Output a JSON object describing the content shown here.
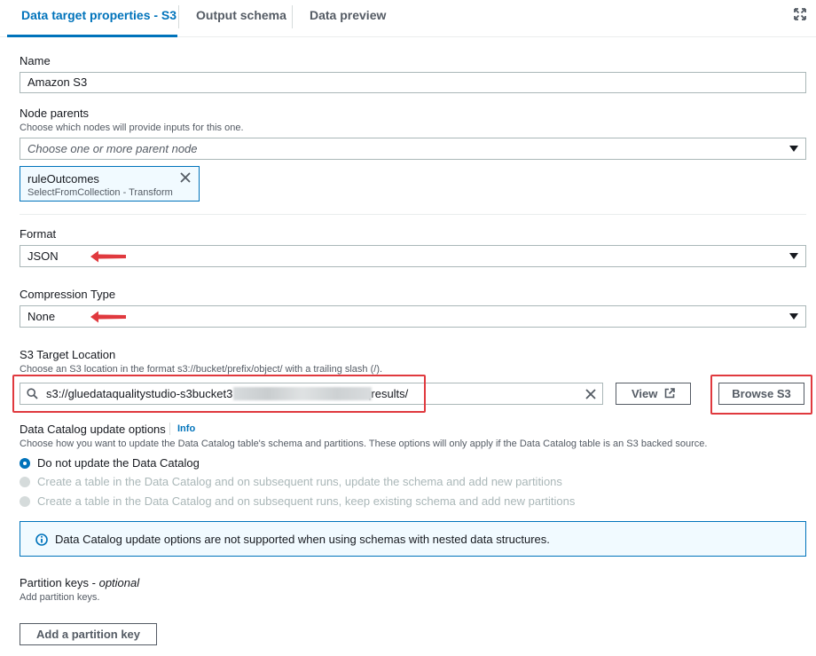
{
  "tabs": [
    {
      "label": "Data target properties - S3",
      "active": true
    },
    {
      "label": "Output schema",
      "active": false
    },
    {
      "label": "Data preview",
      "active": false
    }
  ],
  "name": {
    "label": "Name",
    "value": "Amazon S3"
  },
  "node_parents": {
    "label": "Node parents",
    "description": "Choose which nodes will provide inputs for this one.",
    "placeholder": "Choose one or more parent node",
    "token": {
      "title": "ruleOutcomes",
      "subtitle": "SelectFromCollection - Transform"
    }
  },
  "format": {
    "label": "Format",
    "value": "JSON"
  },
  "compression": {
    "label": "Compression Type",
    "value": "None"
  },
  "s3_target": {
    "label": "S3 Target Location",
    "description": "Choose an S3 location in the format s3://bucket/prefix/object/ with a trailing slash (/).",
    "value_prefix": "s3://gluedataqualitystudio-s3bucket3",
    "value_suffix": "/dqresults/",
    "view_label": "View",
    "browse_label": "Browse S3"
  },
  "catalog_update": {
    "label": "Data Catalog update options",
    "info_label": "Info",
    "description": "Choose how you want to update the Data Catalog table's schema and partitions. These options will only apply if the Data Catalog table is an S3 backed source.",
    "options": [
      {
        "label": "Do not update the Data Catalog",
        "selected": true,
        "disabled": false
      },
      {
        "label": "Create a table in the Data Catalog and on subsequent runs, update the schema and add new partitions",
        "selected": false,
        "disabled": true
      },
      {
        "label": "Create a table in the Data Catalog and on subsequent runs, keep existing schema and add new partitions",
        "selected": false,
        "disabled": true
      }
    ],
    "alert": "Data Catalog update options are not supported when using schemas with nested data structures."
  },
  "partition_keys": {
    "label": "Partition keys - ",
    "optional": "optional",
    "description": "Add partition keys.",
    "button_label": "Add a partition key"
  },
  "colors": {
    "accent": "#0073bb",
    "annotation": "#e0393e",
    "info_bg": "#f1faff"
  }
}
